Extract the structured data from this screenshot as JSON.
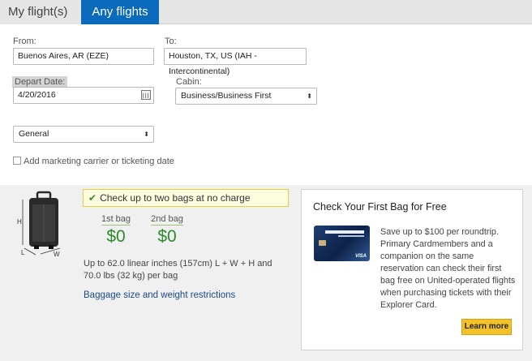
{
  "tabs": [
    {
      "label": "My flight(s)",
      "active": false
    },
    {
      "label": "Any flights",
      "active": true
    }
  ],
  "form": {
    "from_label": "From:",
    "from_value": "Buenos Aires, AR (EZE)",
    "to_label": "To:",
    "to_value": "Houston, TX, US (IAH - Intercontinental)",
    "depart_label": "Depart Date:",
    "depart_value": "4/20/2016",
    "cabin_label": "Cabin:",
    "cabin_value": "Business/Business First",
    "fare_type_value": "General",
    "marketing_checkbox_label": "Add marketing carrier or ticketing date",
    "marketing_checked": false
  },
  "baggage": {
    "diagram_labels": {
      "height": "H",
      "length": "L",
      "width": "W"
    },
    "banner": "Check up to two bags at no charge",
    "bags": [
      {
        "label": "1st bag",
        "price": "$0"
      },
      {
        "label": "2nd bag",
        "price": "$0"
      }
    ],
    "description": "Up to 62.0 linear inches (157cm) L + W + H and 70.0 lbs (32 kg) per bag",
    "link": "Baggage size and weight restrictions"
  },
  "promo": {
    "title": "Check Your First Bag for Free",
    "text": "Save up to $100 per roundtrip. Primary Cardmembers and a companion on the same reservation can check their first bag free on United-operated flights when purchasing tickets with their Explorer Card.",
    "button": "Learn more",
    "card_brand": "VISA"
  },
  "colors": {
    "tab_active": "#0a6bbd",
    "price_green": "#2c8a2a",
    "banner_bg": "#fffde0",
    "link": "#1a4a8a",
    "button": "#f2c228"
  }
}
